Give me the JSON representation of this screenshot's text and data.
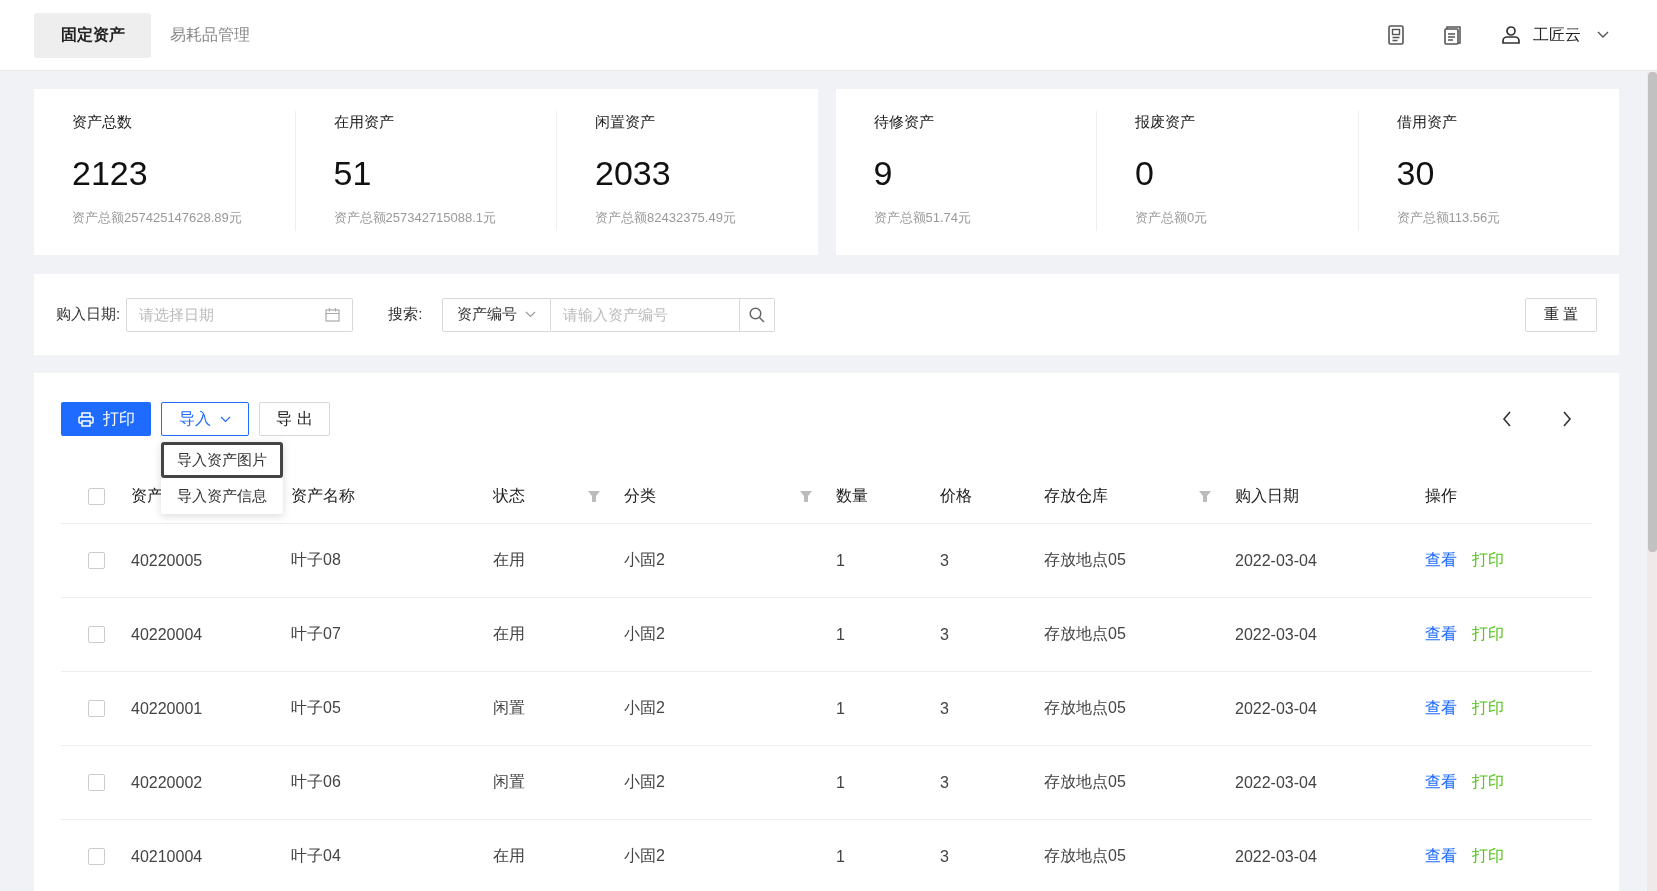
{
  "tabs": [
    {
      "label": "固定资产",
      "selected": true
    },
    {
      "label": "易耗品管理",
      "selected": false
    }
  ],
  "user": {
    "name": "工匠云"
  },
  "stat_groups": [
    [
      {
        "label": "资产总数",
        "value": "2123",
        "amount": "资产总额257425147628.89元"
      },
      {
        "label": "在用资产",
        "value": "51",
        "amount": "资产总额257342715088.1元"
      },
      {
        "label": "闲置资产",
        "value": "2033",
        "amount": "资产总额82432375.49元"
      }
    ],
    [
      {
        "label": "待修资产",
        "value": "9",
        "amount": "资产总额51.74元"
      },
      {
        "label": "报废资产",
        "value": "0",
        "amount": "资产总额0元"
      },
      {
        "label": "借用资产",
        "value": "30",
        "amount": "资产总额113.56元"
      }
    ]
  ],
  "filters": {
    "date_label": "购入日期:",
    "date_placeholder": "请选择日期",
    "search_label": "搜索:",
    "search_type": "资产编号",
    "search_placeholder": "请输入资产编号",
    "reset": "重 置"
  },
  "toolbar": {
    "print": "打印",
    "import": "导入",
    "export": "导 出"
  },
  "import_menu": [
    {
      "label": "导入资产图片",
      "selected": true
    },
    {
      "label": "导入资产信息",
      "selected": false
    }
  ],
  "select_all": {
    "checked": false
  },
  "columns": [
    {
      "label": "资产"
    },
    {
      "label": "资产名称",
      "filter": false
    },
    {
      "label": "状态",
      "filter": true
    },
    {
      "label": "分类",
      "filter": true
    },
    {
      "label": "数量",
      "filter": false
    },
    {
      "label": "价格",
      "filter": false
    },
    {
      "label": "存放仓库",
      "filter": true
    },
    {
      "label": "购入日期",
      "filter": false
    },
    {
      "label": "操作",
      "filter": false
    }
  ],
  "rows": [
    {
      "checked": false,
      "cells": [
        "40220005",
        "叶子08",
        "在用",
        "小固2",
        "1",
        "3",
        "存放地点05",
        "2022-03-04"
      ],
      "actions": [
        "查看",
        "打印"
      ]
    },
    {
      "checked": false,
      "cells": [
        "40220004",
        "叶子07",
        "在用",
        "小固2",
        "1",
        "3",
        "存放地点05",
        "2022-03-04"
      ],
      "actions": [
        "查看",
        "打印"
      ]
    },
    {
      "checked": false,
      "cells": [
        "40220001",
        "叶子05",
        "闲置",
        "小固2",
        "1",
        "3",
        "存放地点05",
        "2022-03-04"
      ],
      "actions": [
        "查看",
        "打印"
      ]
    },
    {
      "checked": false,
      "cells": [
        "40220002",
        "叶子06",
        "闲置",
        "小固2",
        "1",
        "3",
        "存放地点05",
        "2022-03-04"
      ],
      "actions": [
        "查看",
        "打印"
      ]
    },
    {
      "checked": false,
      "cells": [
        "40210004",
        "叶子04",
        "在用",
        "小固2",
        "1",
        "3",
        "存放地点05",
        "2022-03-04"
      ],
      "actions": [
        "查看",
        "打印"
      ]
    }
  ]
}
